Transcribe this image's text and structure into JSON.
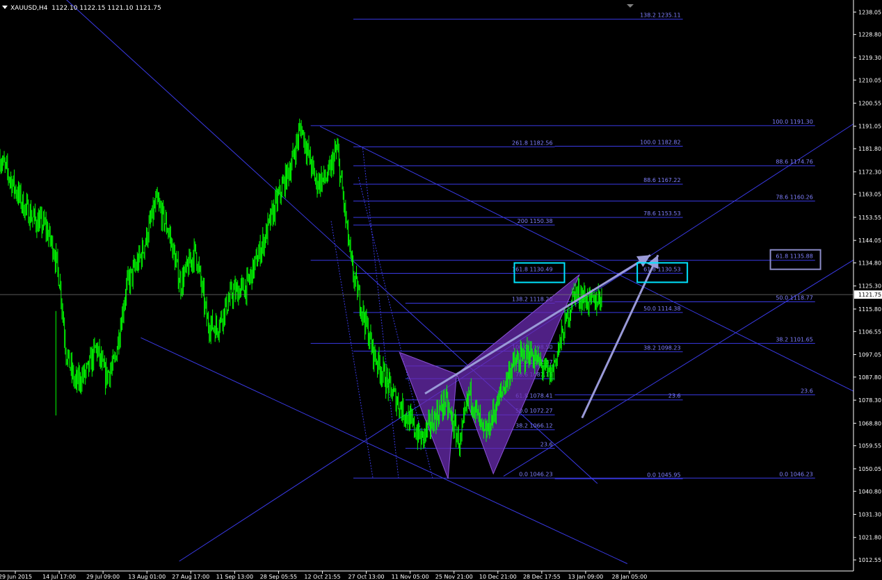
{
  "window": {
    "symbol": "XAUUSD,H4",
    "ohlc": "1122.10 1122.15 1121.10 1121.75"
  },
  "colors": {
    "background": "#000000",
    "candles": "#00ff00",
    "axis": "#ffffff",
    "fib_lines": "#3a3ae6",
    "fib_text": "#8080ff",
    "pattern_fill": "#6a2bb0",
    "arrows": "#9a9ad8",
    "highlight_cyan": "#00e5ff",
    "highlight_grey": "#8c8cc8",
    "price_marker_bg": "#ffffff"
  },
  "chart_data": {
    "type": "candlestick",
    "price_axis_ticks": [
      "1238.05",
      "1228.80",
      "1219.30",
      "1210.05",
      "1200.55",
      "1191.05",
      "1181.80",
      "1172.30",
      "1163.05",
      "1153.55",
      "1144.05",
      "1134.80",
      "1125.30",
      "1115.80",
      "1106.55",
      "1097.05",
      "1087.80",
      "1078.30",
      "1068.80",
      "1059.55",
      "1050.05",
      "1040.80",
      "1031.30",
      "1021.80",
      "1012.55"
    ],
    "time_axis_ticks": [
      "29 Jun 2015",
      "14 Jul 17:00",
      "29 Jul 09:00",
      "13 Aug 01:00",
      "27 Aug 17:00",
      "11 Sep 13:00",
      "28 Sep 05:55",
      "12 Oct 21:55",
      "27 Oct 13:00",
      "11 Nov 05:00",
      "25 Nov 21:00",
      "10 Dec 21:00",
      "28 Dec 17:55",
      "13 Jan 09:00",
      "28 Jan 05:00"
    ],
    "current_price": "1121.75",
    "close_path": [
      [
        1178,
        0.0
      ],
      [
        1168,
        0.02
      ],
      [
        1158,
        0.04
      ],
      [
        1152,
        0.06
      ],
      [
        1150,
        0.075
      ],
      [
        1140,
        0.09
      ],
      [
        1126,
        0.1
      ],
      [
        1098,
        0.11
      ],
      [
        1085,
        0.125
      ],
      [
        1090,
        0.145
      ],
      [
        1100,
        0.16
      ],
      [
        1088,
        0.175
      ],
      [
        1093,
        0.19
      ],
      [
        1125,
        0.21
      ],
      [
        1138,
        0.235
      ],
      [
        1160,
        0.26
      ],
      [
        1148,
        0.28
      ],
      [
        1126,
        0.3
      ],
      [
        1140,
        0.325
      ],
      [
        1110,
        0.345
      ],
      [
        1108,
        0.36
      ],
      [
        1122,
        0.385
      ],
      [
        1125,
        0.41
      ],
      [
        1145,
        0.44
      ],
      [
        1160,
        0.46
      ],
      [
        1176,
        0.485
      ],
      [
        1191,
        0.5
      ],
      [
        1168,
        0.525
      ],
      [
        1170,
        0.545
      ],
      [
        1182,
        0.56
      ],
      [
        1132,
        0.585
      ],
      [
        1098,
        0.62
      ],
      [
        1082,
        0.65
      ],
      [
        1062,
        0.7
      ],
      [
        1078,
        0.74
      ],
      [
        1060,
        0.765
      ],
      [
        1082,
        0.78
      ],
      [
        1063,
        0.805
      ],
      [
        1092,
        0.85
      ],
      [
        1098,
        0.88
      ],
      [
        1088,
        0.915
      ],
      [
        1123,
        0.955
      ],
      [
        1118,
        0.985
      ],
      [
        1121.75,
        1.0
      ]
    ],
    "fib_levels": [
      {
        "label": "138.2 1235.11",
        "price": 1235.11,
        "from": 0.414,
        "to": 0.8
      },
      {
        "label": "100.0 1191.30",
        "price": 1191.3,
        "from": 0.364,
        "to": 0.955
      },
      {
        "label": "261.8 1182.56",
        "price": 1182.56,
        "from": 0.414,
        "to": 0.65
      },
      {
        "label": "100.0 1182.82",
        "price": 1182.82,
        "from": 0.65,
        "to": 0.8
      },
      {
        "label": "88.6 1174.76",
        "price": 1174.76,
        "from": 0.414,
        "to": 0.955
      },
      {
        "label": "88.6 1167.22",
        "price": 1167.22,
        "from": 0.414,
        "to": 0.8
      },
      {
        "label": "78.6 1160.26",
        "price": 1160.26,
        "from": 0.414,
        "to": 0.955
      },
      {
        "label": "78.6 1153.53",
        "price": 1153.53,
        "from": 0.414,
        "to": 0.8
      },
      {
        "label": "200 1150.38",
        "price": 1150.38,
        "from": 0.414,
        "to": 0.65
      },
      {
        "label": "61.8 1135.88",
        "price": 1135.88,
        "from": 0.364,
        "to": 0.955
      },
      {
        "label": "161.8 1130.49",
        "price": 1130.49,
        "from": 0.414,
        "to": 0.65
      },
      {
        "label": "61.8 1130.53",
        "price": 1130.53,
        "from": 0.65,
        "to": 0.8
      },
      {
        "label": "138.2 1118.20",
        "price": 1118.2,
        "from": 0.475,
        "to": 0.65
      },
      {
        "label": "50.0 1118.77",
        "price": 1118.77,
        "from": 0.65,
        "to": 0.955
      },
      {
        "label": "50.0 1114.38",
        "price": 1114.38,
        "from": 0.414,
        "to": 0.8
      },
      {
        "label": "38.2 1101.65",
        "price": 1101.65,
        "from": 0.364,
        "to": 0.955
      },
      {
        "label": "100.0 1098.50",
        "price": 1098.5,
        "from": 0.414,
        "to": 0.65
      },
      {
        "label": "38.2 1098.23",
        "price": 1098.23,
        "from": 0.65,
        "to": 0.8
      },
      {
        "label": "88.6 1092.37",
        "price": 1092.37,
        "from": 0.475,
        "to": 0.65
      },
      {
        "label": "78.6 1087.16",
        "price": 1087.16,
        "from": 0.475,
        "to": 0.65
      },
      {
        "label": "61.8 1078.41",
        "price": 1078.41,
        "from": 0.475,
        "to": 0.65
      },
      {
        "label": "23.6",
        "price": 1080.5,
        "from": 0.65,
        "to": 0.955
      },
      {
        "label": "23.6",
        "price": 1078.4,
        "from": 0.65,
        "to": 0.8
      },
      {
        "label": "50.0 1072.27",
        "price": 1072.27,
        "from": 0.475,
        "to": 0.65
      },
      {
        "label": "38.2 1066.12",
        "price": 1066.12,
        "from": 0.475,
        "to": 0.65
      },
      {
        "label": "23.6",
        "price": 1058.5,
        "from": 0.475,
        "to": 0.65
      },
      {
        "label": "0.0 1046.23",
        "price": 1046.23,
        "from": 0.414,
        "to": 0.65
      },
      {
        "label": "0.0 1045.95",
        "price": 1045.95,
        "from": 0.65,
        "to": 0.8
      },
      {
        "label": "0.0 1046.23",
        "price": 1046.23,
        "from": 0.65,
        "to": 0.955
      }
    ],
    "highlighted_labels": [
      "161.8 1130.49",
      "61.8 1130.53",
      "61.8 1135.88"
    ],
    "price_range": [
      1008,
      1243
    ]
  }
}
